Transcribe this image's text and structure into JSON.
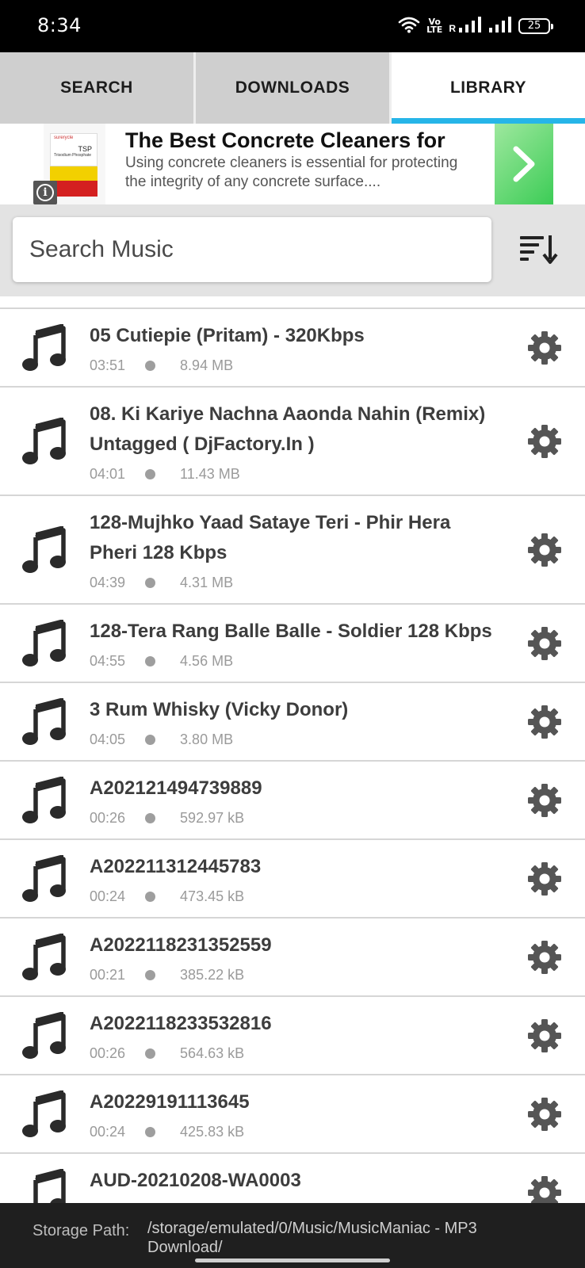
{
  "status_bar": {
    "time": "8:34",
    "volte_line1": "Vo",
    "volte_line2": "LTE",
    "signal_r": "R",
    "battery": "25"
  },
  "tabs": [
    {
      "label": "SEARCH",
      "active": false
    },
    {
      "label": "DOWNLOADS",
      "active": false
    },
    {
      "label": "LIBRARY",
      "active": true
    }
  ],
  "ad": {
    "title": "The Best Concrete Cleaners for",
    "description": "Using concrete cleaners is essential for protecting the integrity of any concrete surface....",
    "info_glyph": "i",
    "image_brand": "surerycle",
    "image_product": "TSP",
    "image_subtitle": "Trisodium Phosphate"
  },
  "search": {
    "placeholder": "Search Music"
  },
  "songs": [
    {
      "title": "05 Cutiepie (Pritam) - 320Kbps",
      "duration": "03:51",
      "size": "8.94 MB"
    },
    {
      "title": "08. Ki Kariye Nachna Aaonda Nahin (Remix) Untagged ( DjFactory.In )",
      "duration": "04:01",
      "size": "11.43 MB"
    },
    {
      "title": "128-Mujhko Yaad Sataye Teri - Phir Hera Pheri 128 Kbps",
      "duration": "04:39",
      "size": "4.31 MB"
    },
    {
      "title": "128-Tera Rang Balle Balle - Soldier 128 Kbps",
      "duration": "04:55",
      "size": "4.56 MB"
    },
    {
      "title": "3 Rum Whisky (Vicky Donor)",
      "duration": "04:05",
      "size": "3.80 MB"
    },
    {
      "title": "A202121494739889",
      "duration": "00:26",
      "size": "592.97 kB"
    },
    {
      "title": "A202211312445783",
      "duration": "00:24",
      "size": "473.45 kB"
    },
    {
      "title": "A2022118231352559",
      "duration": "00:21",
      "size": "385.22 kB"
    },
    {
      "title": "A2022118233532816",
      "duration": "00:26",
      "size": "564.63 kB"
    },
    {
      "title": "A20229191113645",
      "duration": "00:24",
      "size": "425.83 kB"
    },
    {
      "title": "AUD-20210208-WA0003",
      "duration": "",
      "size": ""
    }
  ],
  "storage": {
    "label": "Storage Path:",
    "path": "/storage/emulated/0/Music/MusicManiac - MP3 Download/"
  },
  "colors": {
    "tab_indicator": "#26b5e8",
    "ad_arrow": "#3ccc56",
    "status_bar": "#000000",
    "bottom_bar": "#1f1f1f"
  }
}
